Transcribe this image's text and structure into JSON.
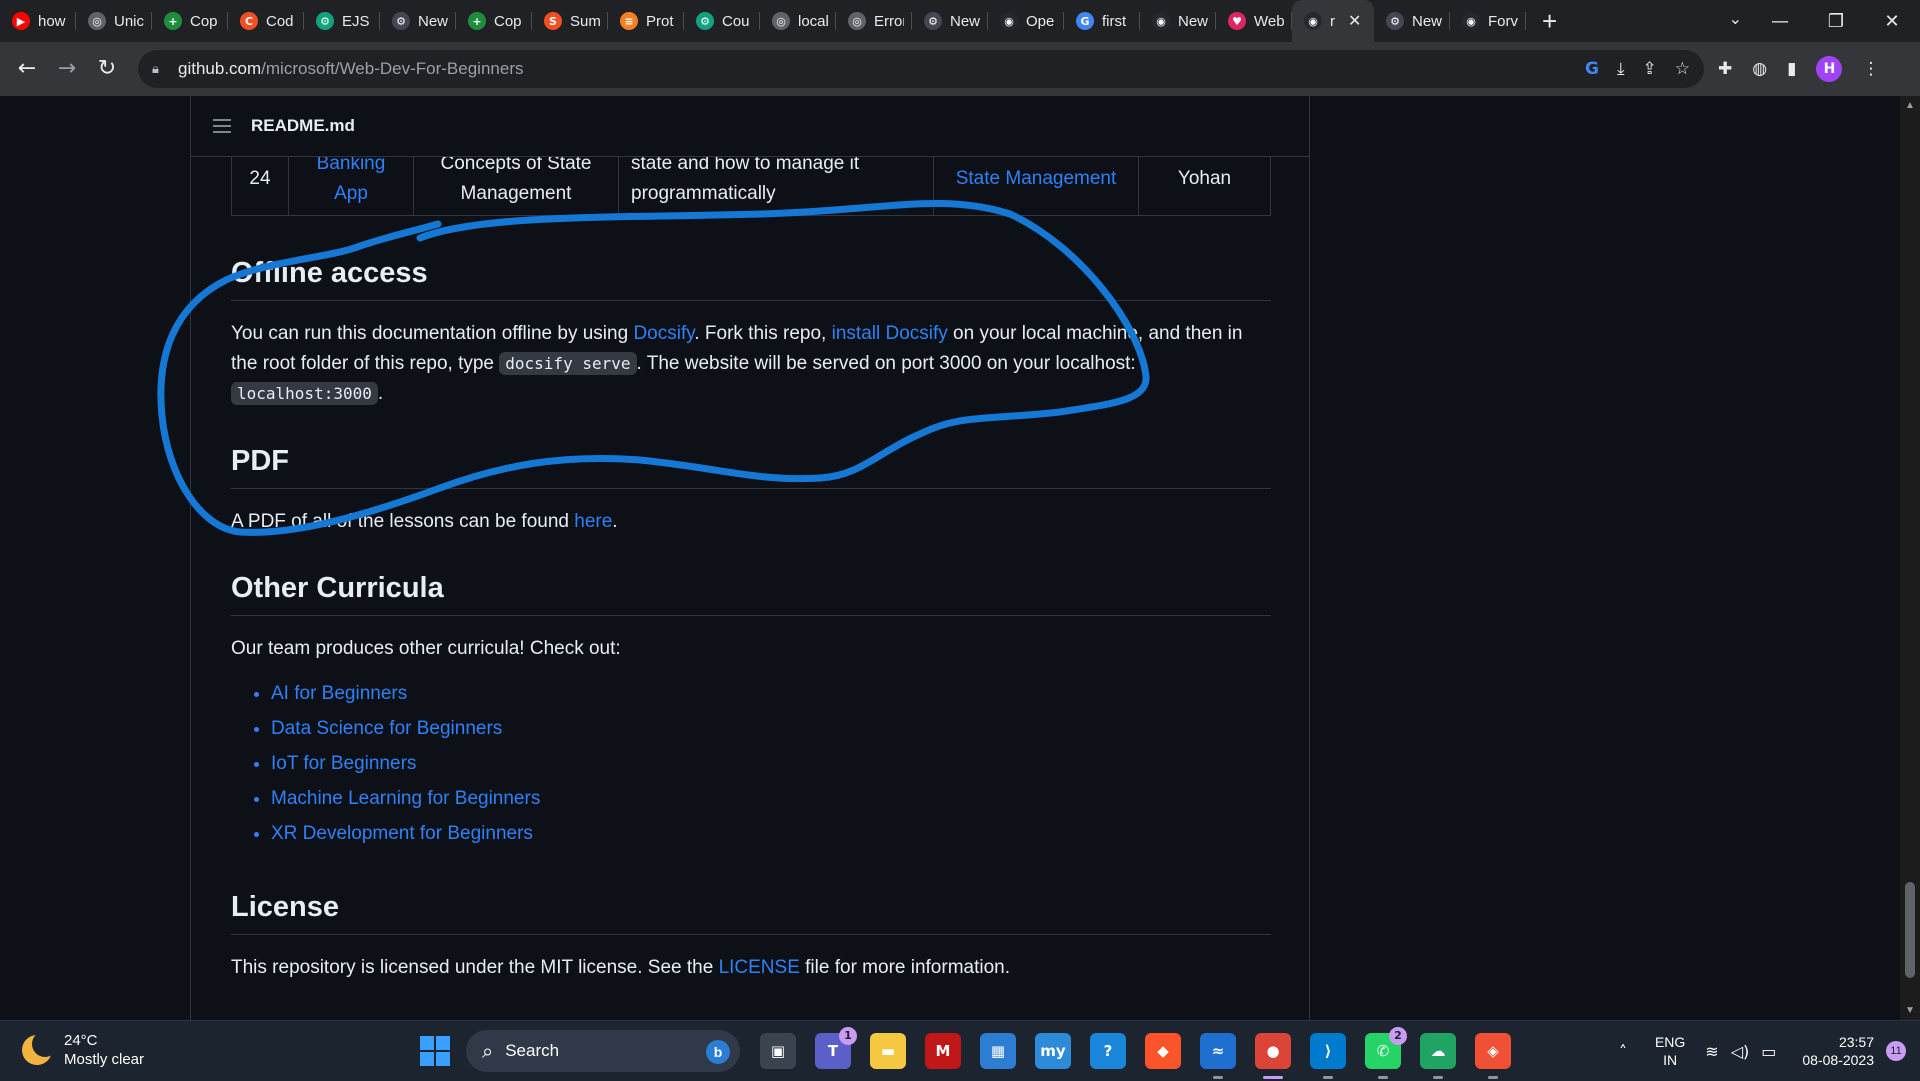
{
  "browser": {
    "tabs": [
      {
        "title": "how",
        "icon": "youtube-icon",
        "color": "#ff0000",
        "glyph": "▶"
      },
      {
        "title": "Unic",
        "icon": "globe-icon",
        "color": "#5f6368",
        "glyph": "◎"
      },
      {
        "title": "Cop",
        "icon": "plus-doc-icon",
        "color": "#1e8e3e",
        "glyph": "+"
      },
      {
        "title": "Cod",
        "icon": "code-icon",
        "color": "#f25022",
        "glyph": "C"
      },
      {
        "title": "EJS",
        "icon": "chatgpt-icon",
        "color": "#10a37f",
        "glyph": "⚙"
      },
      {
        "title": "New",
        "icon": "chatgpt-icon",
        "color": "#444654",
        "glyph": "⚙"
      },
      {
        "title": "Cop",
        "icon": "plus-doc-icon",
        "color": "#1e8e3e",
        "glyph": "+"
      },
      {
        "title": "Sum",
        "icon": "code-icon",
        "color": "#f25022",
        "glyph": "S"
      },
      {
        "title": "Prot",
        "icon": "stack-icon",
        "color": "#f48024",
        "glyph": "≡"
      },
      {
        "title": "Cou",
        "icon": "chatgpt-icon",
        "color": "#10a37f",
        "glyph": "⚙"
      },
      {
        "title": "local",
        "icon": "globe-icon",
        "color": "#5f6368",
        "glyph": "◎"
      },
      {
        "title": "Error",
        "icon": "globe-icon",
        "color": "#5f6368",
        "glyph": "◎"
      },
      {
        "title": "New",
        "icon": "chatgpt-icon",
        "color": "#444654",
        "glyph": "⚙"
      },
      {
        "title": "Ope",
        "icon": "github-icon",
        "color": "#24292f",
        "glyph": "◉"
      },
      {
        "title": "first",
        "icon": "google-icon",
        "color": "#4285f4",
        "glyph": "G"
      },
      {
        "title": "New",
        "icon": "github-icon",
        "color": "#24292f",
        "glyph": "◉"
      },
      {
        "title": "Web",
        "icon": "heart-icon",
        "color": "#e0245e",
        "glyph": "♥"
      },
      {
        "title": "r",
        "icon": "github-icon",
        "color": "#24292f",
        "glyph": "◉",
        "active": true
      },
      {
        "title": "New",
        "icon": "chatgpt-icon",
        "color": "#444654",
        "glyph": "⚙"
      },
      {
        "title": "Forv",
        "icon": "github-icon",
        "color": "#24292f",
        "glyph": "◉"
      }
    ],
    "url_host": "github.com",
    "url_path": "/microsoft/Web-Dev-For-Beginners",
    "profile_initial": "H"
  },
  "readme": {
    "filename": "README.md",
    "table_row": {
      "number": "24",
      "project": "Banking App",
      "concept": "Concepts of State Management",
      "description": "state and how to manage it programmatically",
      "lesson": "State Management",
      "author": "Yohan"
    },
    "offline": {
      "heading": "Offline access",
      "t1": "You can run this documentation offline by using ",
      "link1": "Docsify",
      "t2": ". Fork this repo, ",
      "link2": "install Docsify",
      "t3": " on your local machine, and then in the root folder of this repo, type ",
      "code1": "docsify serve",
      "t4": ". The website will be served on port 3000 on your localhost: ",
      "code2": "localhost:3000",
      "t5": "."
    },
    "pdf": {
      "heading": "PDF",
      "t1": "A PDF of all of the lessons can be found ",
      "link": "here",
      "t2": "."
    },
    "other": {
      "heading": "Other Curricula",
      "intro": "Our team produces other curricula! Check out:",
      "items": [
        "AI for Beginners",
        "Data Science for Beginners",
        "IoT for Beginners",
        "Machine Learning for Beginners",
        "XR Development for Beginners"
      ]
    },
    "license": {
      "heading": "License",
      "t1": "This repository is licensed under the MIT license. See the ",
      "link": "LICENSE",
      "t2": " file for more information."
    }
  },
  "taskbar": {
    "temperature": "24°C",
    "weather": "Mostly clear",
    "search_label": "Search",
    "apps": [
      {
        "name": "task-view",
        "color": "#3b4350",
        "glyph": "▣"
      },
      {
        "name": "teams",
        "color": "#5b5fc7",
        "glyph": "T",
        "badge": "1"
      },
      {
        "name": "file-explorer",
        "color": "#f5c842",
        "glyph": "▬"
      },
      {
        "name": "mcafee",
        "color": "#c01818",
        "glyph": "M"
      },
      {
        "name": "microsoft-store",
        "color": "#2d7dd2",
        "glyph": "▦"
      },
      {
        "name": "myasus",
        "color": "#2e8bd8",
        "glyph": "my"
      },
      {
        "name": "help",
        "color": "#1a86d9",
        "glyph": "?"
      },
      {
        "name": "brave",
        "color": "#fb542b",
        "glyph": "◆"
      },
      {
        "name": "remote",
        "color": "#1f6fd1",
        "glyph": "≈"
      },
      {
        "name": "chrome",
        "color": "#db4437",
        "glyph": "●",
        "active": true
      },
      {
        "name": "vscode",
        "color": "#007acc",
        "glyph": "⟩"
      },
      {
        "name": "whatsapp",
        "color": "#25d366",
        "glyph": "✆",
        "badge": "2"
      },
      {
        "name": "cloud-app",
        "color": "#1fa463",
        "glyph": "☁"
      },
      {
        "name": "git",
        "color": "#f05033",
        "glyph": "◈"
      }
    ],
    "lang_top": "ENG",
    "lang_bottom": "IN",
    "time": "23:57",
    "date": "08-08-2023",
    "notifications": "11"
  }
}
